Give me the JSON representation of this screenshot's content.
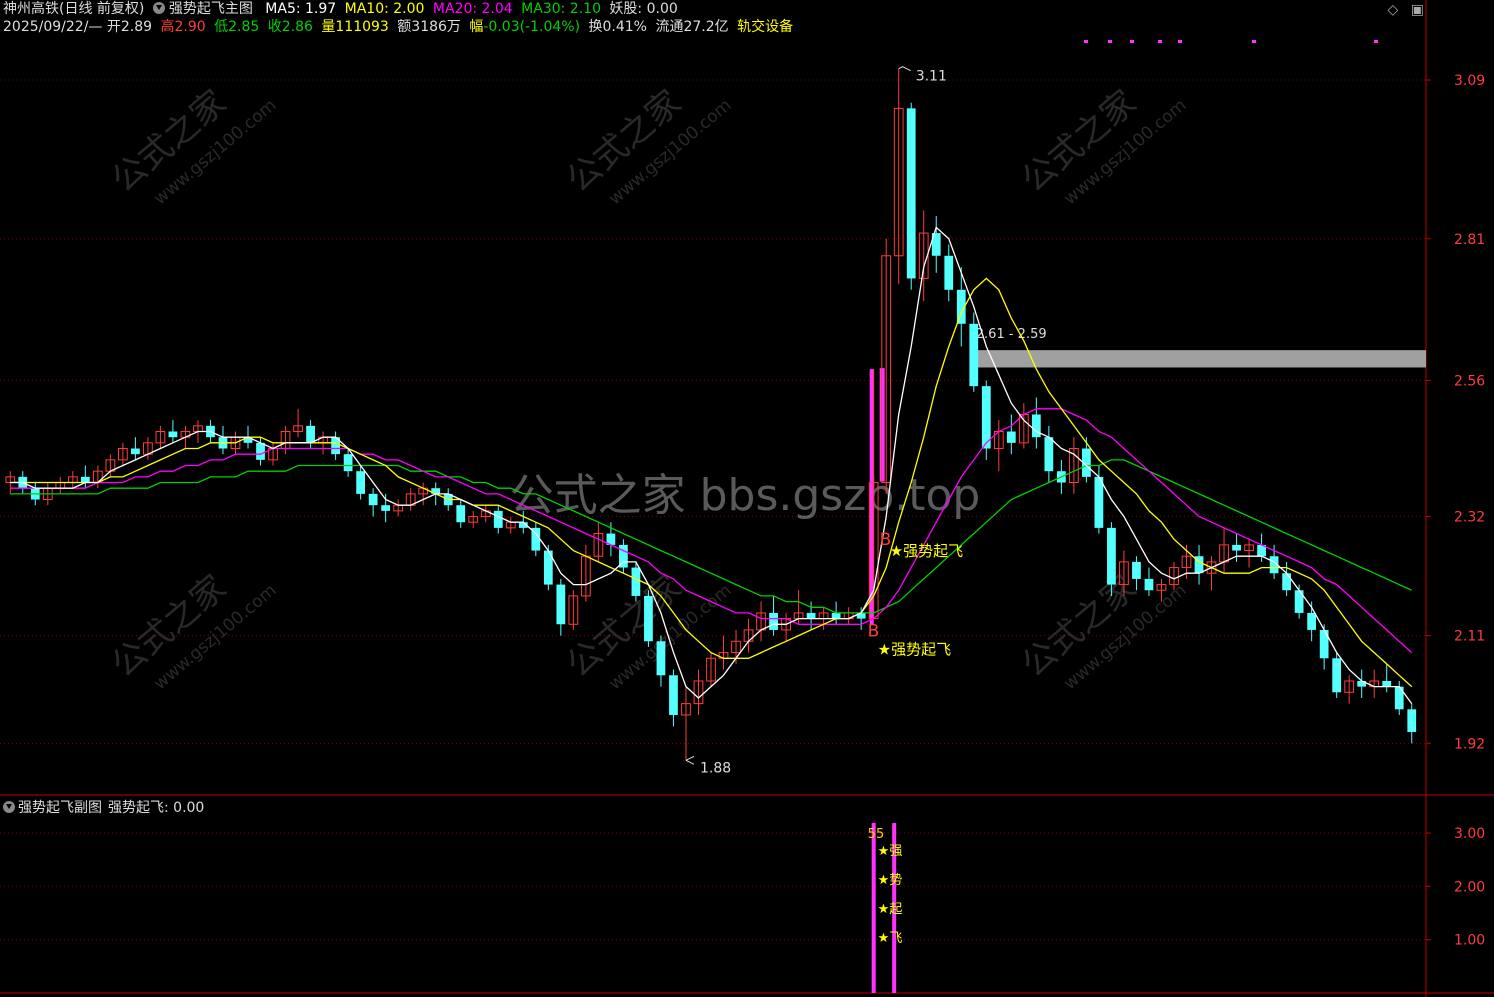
{
  "header": {
    "stock_name": "神州高铁(日线 前复权)",
    "indicator_name": "强势起飞主图",
    "ma5_label": "MA5: 1.97",
    "ma10_label": "MA10: 2.00",
    "ma20_label": "MA20: 2.04",
    "ma30_label": "MA30: 2.10",
    "yaogu_label": "妖股: 0.00",
    "date": "2025/09/22/—",
    "open_label": "开",
    "open": "2.89",
    "high_label": "高",
    "high": "2.90",
    "low_label": "低",
    "low": "2.85",
    "close_label": "收",
    "close": "2.86",
    "volume_label": "量",
    "volume": "111093",
    "amount": "额3186万",
    "change_label": "幅",
    "change": "-0.03(-1.04%)",
    "turnover": "换0.41%",
    "float_cap": "流通27.2亿",
    "sector": "轨交设备"
  },
  "sub_header": {
    "name": "强势起飞副图",
    "value_label": "强势起飞: 0.00"
  },
  "watermark": {
    "main": "公式之家 bbs.gszb.top",
    "tile_cn": "公式之家",
    "tile_url": "www.gszj100.com"
  },
  "annotations": {
    "peak": "3.11",
    "trough": "1.88",
    "gap_zone": "2.61 - 2.59",
    "buy_mark": "B",
    "signal_text": "★强势起飞",
    "sub_chars": [
      "强",
      "势",
      "起",
      "飞"
    ],
    "sub_markers": "55"
  },
  "colors": {
    "up": "#ff3c3c",
    "down": "#54ffff",
    "ma5": "#ffffff",
    "ma10": "#ffff00",
    "ma20": "#ff00ff",
    "ma30": "#00d000",
    "axis": "#c00000",
    "signal": "#ff33ff",
    "text_yellow": "#ffff00"
  },
  "chart_data": {
    "type": "candlestick",
    "y_ticks": [
      "3.09",
      "2.81",
      "2.56",
      "2.32",
      "2.11",
      "1.92"
    ],
    "y_tick_values": [
      3.09,
      2.81,
      2.56,
      2.32,
      2.11,
      1.92
    ],
    "ylim": [
      1.85,
      3.15
    ],
    "sub_y_ticks": [
      "3.00",
      "2.00",
      "1.00"
    ],
    "sub_y_tick_values": [
      3.0,
      2.0,
      1.0
    ],
    "sub_ylim": [
      0,
      3.3
    ],
    "candles_ohlc": [
      [
        2.38,
        2.4,
        2.36,
        2.39
      ],
      [
        2.39,
        2.4,
        2.36,
        2.37
      ],
      [
        2.37,
        2.38,
        2.34,
        2.35
      ],
      [
        2.35,
        2.38,
        2.34,
        2.37
      ],
      [
        2.37,
        2.39,
        2.36,
        2.38
      ],
      [
        2.38,
        2.4,
        2.37,
        2.39
      ],
      [
        2.39,
        2.41,
        2.37,
        2.38
      ],
      [
        2.38,
        2.41,
        2.37,
        2.4
      ],
      [
        2.4,
        2.43,
        2.39,
        2.42
      ],
      [
        2.42,
        2.45,
        2.41,
        2.44
      ],
      [
        2.44,
        2.46,
        2.42,
        2.43
      ],
      [
        2.43,
        2.46,
        2.42,
        2.45
      ],
      [
        2.45,
        2.48,
        2.44,
        2.47
      ],
      [
        2.47,
        2.49,
        2.45,
        2.46
      ],
      [
        2.46,
        2.48,
        2.44,
        2.47
      ],
      [
        2.47,
        2.49,
        2.45,
        2.48
      ],
      [
        2.48,
        2.49,
        2.45,
        2.46
      ],
      [
        2.46,
        2.48,
        2.43,
        2.44
      ],
      [
        2.44,
        2.47,
        2.43,
        2.46
      ],
      [
        2.46,
        2.48,
        2.44,
        2.45
      ],
      [
        2.45,
        2.46,
        2.41,
        2.42
      ],
      [
        2.42,
        2.45,
        2.41,
        2.44
      ],
      [
        2.44,
        2.48,
        2.43,
        2.47
      ],
      [
        2.47,
        2.51,
        2.46,
        2.48
      ],
      [
        2.48,
        2.49,
        2.44,
        2.45
      ],
      [
        2.45,
        2.47,
        2.43,
        2.46
      ],
      [
        2.46,
        2.47,
        2.42,
        2.43
      ],
      [
        2.43,
        2.44,
        2.39,
        2.4
      ],
      [
        2.4,
        2.41,
        2.35,
        2.36
      ],
      [
        2.36,
        2.37,
        2.32,
        2.34
      ],
      [
        2.34,
        2.36,
        2.31,
        2.33
      ],
      [
        2.33,
        2.35,
        2.32,
        2.34
      ],
      [
        2.34,
        2.37,
        2.33,
        2.36
      ],
      [
        2.36,
        2.38,
        2.34,
        2.37
      ],
      [
        2.37,
        2.38,
        2.34,
        2.36
      ],
      [
        2.36,
        2.37,
        2.33,
        2.34
      ],
      [
        2.34,
        2.35,
        2.3,
        2.31
      ],
      [
        2.31,
        2.33,
        2.3,
        2.32
      ],
      [
        2.32,
        2.34,
        2.31,
        2.33
      ],
      [
        2.33,
        2.34,
        2.29,
        2.3
      ],
      [
        2.3,
        2.32,
        2.29,
        2.31
      ],
      [
        2.31,
        2.33,
        2.29,
        2.3
      ],
      [
        2.3,
        2.31,
        2.25,
        2.26
      ],
      [
        2.26,
        2.27,
        2.19,
        2.2
      ],
      [
        2.2,
        2.21,
        2.11,
        2.13
      ],
      [
        2.13,
        2.19,
        2.12,
        2.18
      ],
      [
        2.18,
        2.27,
        2.17,
        2.25
      ],
      [
        2.25,
        2.31,
        2.24,
        2.29
      ],
      [
        2.29,
        2.31,
        2.25,
        2.27
      ],
      [
        2.27,
        2.28,
        2.22,
        2.23
      ],
      [
        2.23,
        2.24,
        2.17,
        2.18
      ],
      [
        2.18,
        2.19,
        2.09,
        2.1
      ],
      [
        2.1,
        2.11,
        2.02,
        2.04
      ],
      [
        2.04,
        2.05,
        1.95,
        1.97
      ],
      [
        1.97,
        2.02,
        1.89,
        1.99
      ],
      [
        1.99,
        2.05,
        1.97,
        2.03
      ],
      [
        2.03,
        2.08,
        2.02,
        2.07
      ],
      [
        2.07,
        2.11,
        2.05,
        2.08
      ],
      [
        2.08,
        2.12,
        2.06,
        2.1
      ],
      [
        2.1,
        2.14,
        2.08,
        2.12
      ],
      [
        2.12,
        2.17,
        2.1,
        2.15
      ],
      [
        2.15,
        2.18,
        2.11,
        2.12
      ],
      [
        2.12,
        2.15,
        2.1,
        2.14
      ],
      [
        2.14,
        2.19,
        2.13,
        2.15
      ],
      [
        2.15,
        2.17,
        2.12,
        2.14
      ],
      [
        2.14,
        2.16,
        2.12,
        2.15
      ],
      [
        2.15,
        2.17,
        2.13,
        2.14
      ],
      [
        2.14,
        2.16,
        2.13,
        2.15
      ],
      [
        2.15,
        2.16,
        2.12,
        2.14
      ],
      [
        2.14,
        2.58,
        2.14,
        2.38
      ],
      [
        2.38,
        2.81,
        2.36,
        2.78
      ],
      [
        2.78,
        3.11,
        2.73,
        3.04
      ],
      [
        3.04,
        3.05,
        2.72,
        2.74
      ],
      [
        2.74,
        2.86,
        2.7,
        2.82
      ],
      [
        2.82,
        2.85,
        2.75,
        2.78
      ],
      [
        2.78,
        2.8,
        2.7,
        2.72
      ],
      [
        2.72,
        2.76,
        2.62,
        2.66
      ],
      [
        2.66,
        2.68,
        2.54,
        2.55
      ],
      [
        2.55,
        2.56,
        2.42,
        2.44
      ],
      [
        2.44,
        2.49,
        2.4,
        2.47
      ],
      [
        2.47,
        2.5,
        2.43,
        2.45
      ],
      [
        2.45,
        2.52,
        2.44,
        2.5
      ],
      [
        2.5,
        2.53,
        2.44,
        2.46
      ],
      [
        2.46,
        2.48,
        2.38,
        2.4
      ],
      [
        2.4,
        2.42,
        2.36,
        2.38
      ],
      [
        2.38,
        2.46,
        2.36,
        2.44
      ],
      [
        2.44,
        2.46,
        2.38,
        2.39
      ],
      [
        2.39,
        2.41,
        2.29,
        2.3
      ],
      [
        2.3,
        2.31,
        2.18,
        2.2
      ],
      [
        2.2,
        2.26,
        2.18,
        2.24
      ],
      [
        2.24,
        2.25,
        2.19,
        2.21
      ],
      [
        2.21,
        2.23,
        2.18,
        2.19
      ],
      [
        2.19,
        2.21,
        2.17,
        2.2
      ],
      [
        2.2,
        2.24,
        2.19,
        2.23
      ],
      [
        2.23,
        2.27,
        2.21,
        2.25
      ],
      [
        2.25,
        2.27,
        2.2,
        2.22
      ],
      [
        2.22,
        2.25,
        2.19,
        2.24
      ],
      [
        2.24,
        2.3,
        2.22,
        2.27
      ],
      [
        2.27,
        2.29,
        2.24,
        2.26
      ],
      [
        2.26,
        2.28,
        2.23,
        2.27
      ],
      [
        2.27,
        2.29,
        2.24,
        2.25
      ],
      [
        2.25,
        2.27,
        2.21,
        2.22
      ],
      [
        2.22,
        2.24,
        2.18,
        2.19
      ],
      [
        2.19,
        2.2,
        2.14,
        2.15
      ],
      [
        2.15,
        2.17,
        2.1,
        2.12
      ],
      [
        2.12,
        2.13,
        2.05,
        2.07
      ],
      [
        2.07,
        2.08,
        2.0,
        2.01
      ],
      [
        2.01,
        2.04,
        1.99,
        2.03
      ],
      [
        2.03,
        2.05,
        2.0,
        2.02
      ],
      [
        2.02,
        2.05,
        2.0,
        2.03
      ],
      [
        2.03,
        2.06,
        2.01,
        2.02
      ],
      [
        2.02,
        2.03,
        1.97,
        1.98
      ],
      [
        1.98,
        1.99,
        1.92,
        1.94
      ]
    ],
    "ma5": [
      2.38,
      2.38,
      2.37,
      2.37,
      2.37,
      2.37,
      2.38,
      2.38,
      2.4,
      2.41,
      2.42,
      2.43,
      2.44,
      2.45,
      2.46,
      2.47,
      2.47,
      2.46,
      2.46,
      2.46,
      2.45,
      2.44,
      2.45,
      2.45,
      2.45,
      2.46,
      2.46,
      2.44,
      2.41,
      2.38,
      2.35,
      2.34,
      2.34,
      2.35,
      2.36,
      2.36,
      2.35,
      2.34,
      2.33,
      2.32,
      2.31,
      2.31,
      2.29,
      2.26,
      2.22,
      2.2,
      2.2,
      2.21,
      2.22,
      2.24,
      2.24,
      2.2,
      2.15,
      2.08,
      2.02,
      2.0,
      2.02,
      2.04,
      2.07,
      2.1,
      2.12,
      2.13,
      2.13,
      2.14,
      2.14,
      2.14,
      2.14,
      2.14,
      2.15,
      2.19,
      2.32,
      2.5,
      2.62,
      2.76,
      2.83,
      2.81,
      2.75,
      2.69,
      2.62,
      2.57,
      2.52,
      2.49,
      2.47,
      2.46,
      2.44,
      2.43,
      2.41,
      2.39,
      2.35,
      2.32,
      2.28,
      2.24,
      2.22,
      2.21,
      2.22,
      2.22,
      2.23,
      2.24,
      2.25,
      2.25,
      2.25,
      2.24,
      2.22,
      2.19,
      2.16,
      2.12,
      2.08,
      2.05,
      2.03,
      2.02,
      2.02,
      2.02,
      1.99
    ],
    "ma10": [
      2.38,
      2.38,
      2.38,
      2.38,
      2.38,
      2.38,
      2.38,
      2.38,
      2.39,
      2.39,
      2.4,
      2.41,
      2.42,
      2.43,
      2.44,
      2.44,
      2.45,
      2.45,
      2.45,
      2.46,
      2.46,
      2.45,
      2.45,
      2.45,
      2.45,
      2.45,
      2.45,
      2.44,
      2.43,
      2.42,
      2.41,
      2.39,
      2.38,
      2.37,
      2.36,
      2.35,
      2.35,
      2.34,
      2.34,
      2.34,
      2.33,
      2.32,
      2.31,
      2.3,
      2.28,
      2.26,
      2.25,
      2.24,
      2.23,
      2.22,
      2.21,
      2.2,
      2.18,
      2.15,
      2.12,
      2.1,
      2.08,
      2.07,
      2.07,
      2.07,
      2.08,
      2.09,
      2.1,
      2.11,
      2.12,
      2.13,
      2.14,
      2.14,
      2.15,
      2.18,
      2.23,
      2.31,
      2.38,
      2.46,
      2.55,
      2.62,
      2.68,
      2.72,
      2.74,
      2.72,
      2.67,
      2.63,
      2.58,
      2.54,
      2.51,
      2.48,
      2.45,
      2.42,
      2.4,
      2.38,
      2.36,
      2.33,
      2.31,
      2.28,
      2.26,
      2.24,
      2.23,
      2.22,
      2.22,
      2.22,
      2.23,
      2.23,
      2.23,
      2.22,
      2.21,
      2.19,
      2.16,
      2.13,
      2.1,
      2.08,
      2.06,
      2.04,
      2.02
    ],
    "ma20": [
      2.37,
      2.37,
      2.37,
      2.37,
      2.37,
      2.37,
      2.37,
      2.38,
      2.38,
      2.38,
      2.39,
      2.39,
      2.4,
      2.4,
      2.41,
      2.41,
      2.42,
      2.42,
      2.43,
      2.43,
      2.43,
      2.44,
      2.44,
      2.44,
      2.44,
      2.44,
      2.44,
      2.44,
      2.43,
      2.43,
      2.42,
      2.42,
      2.41,
      2.4,
      2.39,
      2.39,
      2.38,
      2.37,
      2.36,
      2.36,
      2.35,
      2.34,
      2.33,
      2.32,
      2.31,
      2.3,
      2.29,
      2.28,
      2.27,
      2.26,
      2.25,
      2.24,
      2.22,
      2.21,
      2.19,
      2.18,
      2.17,
      2.16,
      2.15,
      2.15,
      2.14,
      2.14,
      2.14,
      2.13,
      2.13,
      2.13,
      2.13,
      2.13,
      2.13,
      2.14,
      2.16,
      2.19,
      2.23,
      2.27,
      2.31,
      2.35,
      2.39,
      2.42,
      2.45,
      2.47,
      2.48,
      2.5,
      2.51,
      2.51,
      2.51,
      2.5,
      2.49,
      2.47,
      2.46,
      2.44,
      2.42,
      2.4,
      2.38,
      2.36,
      2.34,
      2.32,
      2.31,
      2.3,
      2.29,
      2.28,
      2.27,
      2.26,
      2.25,
      2.24,
      2.23,
      2.21,
      2.2,
      2.18,
      2.16,
      2.14,
      2.12,
      2.1,
      2.08
    ],
    "ma30": [
      2.36,
      2.36,
      2.36,
      2.36,
      2.36,
      2.36,
      2.36,
      2.36,
      2.37,
      2.37,
      2.37,
      2.37,
      2.38,
      2.38,
      2.38,
      2.38,
      2.39,
      2.39,
      2.39,
      2.4,
      2.4,
      2.4,
      2.4,
      2.41,
      2.41,
      2.41,
      2.41,
      2.41,
      2.41,
      2.41,
      2.41,
      2.41,
      2.4,
      2.4,
      2.4,
      2.39,
      2.39,
      2.38,
      2.38,
      2.37,
      2.37,
      2.36,
      2.36,
      2.35,
      2.34,
      2.33,
      2.32,
      2.31,
      2.3,
      2.29,
      2.28,
      2.27,
      2.26,
      2.25,
      2.24,
      2.23,
      2.22,
      2.21,
      2.2,
      2.19,
      2.18,
      2.18,
      2.17,
      2.17,
      2.16,
      2.16,
      2.15,
      2.15,
      2.15,
      2.15,
      2.16,
      2.17,
      2.19,
      2.21,
      2.23,
      2.25,
      2.27,
      2.29,
      2.31,
      2.33,
      2.35,
      2.36,
      2.37,
      2.38,
      2.39,
      2.4,
      2.41,
      2.41,
      2.42,
      2.42,
      2.41,
      2.4,
      2.39,
      2.38,
      2.37,
      2.36,
      2.35,
      2.34,
      2.33,
      2.32,
      2.31,
      2.3,
      2.29,
      2.28,
      2.27,
      2.26,
      2.25,
      2.24,
      2.23,
      2.22,
      2.21,
      2.2,
      2.19
    ],
    "signal_bar_index": 69,
    "gap_zone_range": [
      2.59,
      2.61
    ],
    "gap_zone_start_index": 77,
    "sub_signal_indices": [
      69,
      70
    ],
    "sub_signal_value": 3.0
  }
}
